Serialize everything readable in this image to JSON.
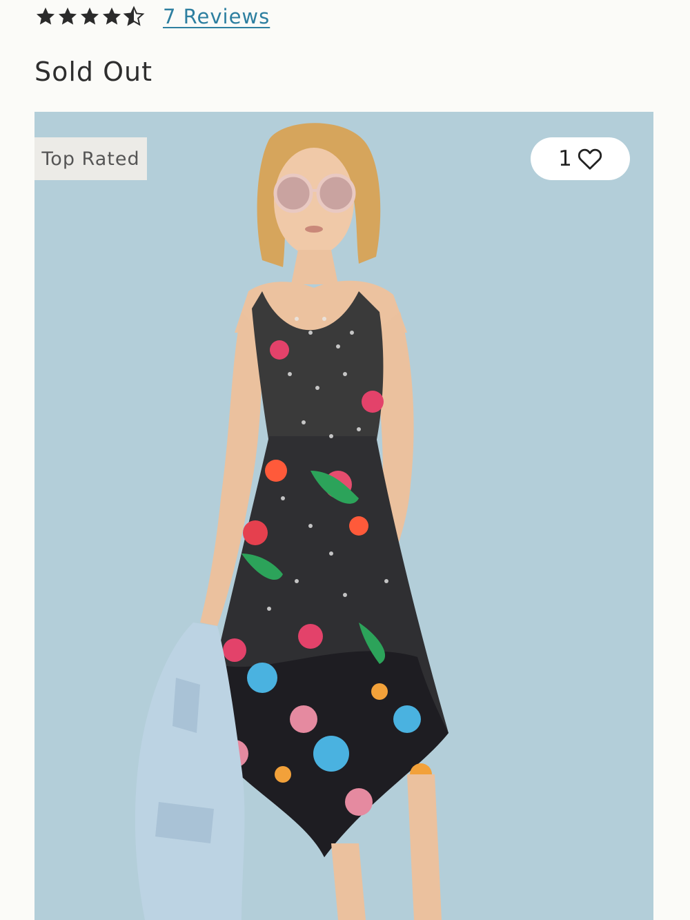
{
  "rating": {
    "stars_value": 4.5,
    "stars_max": 5,
    "star_color": "#2b2b2b",
    "star_icon": "star-icon",
    "reviews_label": "7 Reviews",
    "link_color": "#2d7fa0"
  },
  "product": {
    "status": "Sold Out",
    "badge": "Top Rated",
    "favorites_count": "1",
    "favorite_icon": "heart-outline-icon",
    "image_description_icon": "product-photo"
  },
  "colors": {
    "background": "#fbfbf8",
    "photo_backdrop": "#b2cdd8",
    "badge_bg": "#ecebe7",
    "pill_bg": "#ffffff"
  }
}
